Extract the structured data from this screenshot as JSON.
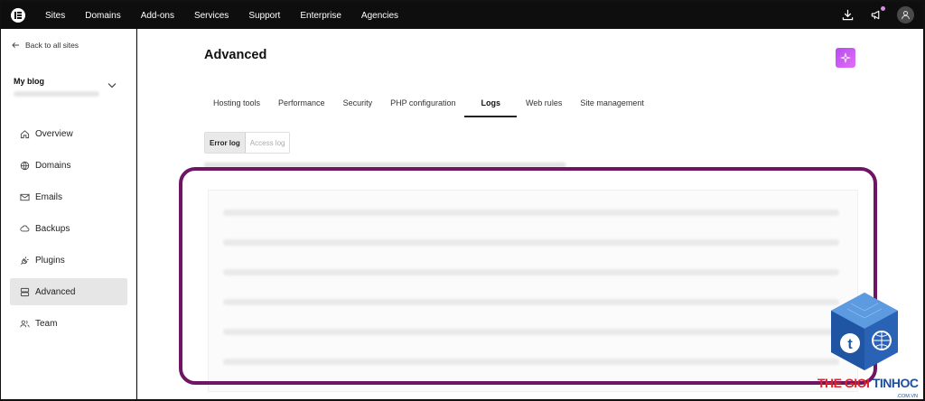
{
  "topnav": {
    "items": [
      "Sites",
      "Domains",
      "Add-ons",
      "Services",
      "Support",
      "Enterprise",
      "Agencies"
    ]
  },
  "sidebar": {
    "back_label": "Back to all sites",
    "site_name": "My blog",
    "items": [
      {
        "label": "Overview",
        "icon": "home-icon"
      },
      {
        "label": "Domains",
        "icon": "globe-icon"
      },
      {
        "label": "Emails",
        "icon": "mail-icon"
      },
      {
        "label": "Backups",
        "icon": "cloud-icon"
      },
      {
        "label": "Plugins",
        "icon": "plug-icon"
      },
      {
        "label": "Advanced",
        "icon": "server-icon",
        "active": true
      },
      {
        "label": "Team",
        "icon": "users-icon"
      }
    ]
  },
  "main": {
    "title": "Advanced",
    "tabs": [
      "Hosting tools",
      "Performance",
      "Security",
      "PHP configuration",
      "Logs",
      "Web rules",
      "Site management"
    ],
    "active_tab": "Logs",
    "log_types": [
      "Error log",
      "Access log"
    ],
    "active_log_type": "Error log"
  },
  "watermark": {
    "brand_red": "THE GIOI ",
    "brand_blue": "TINHOC",
    "domain": ".COM.VN"
  },
  "colors": {
    "highlight": "#6e1565",
    "accent": "#c85cf2"
  }
}
